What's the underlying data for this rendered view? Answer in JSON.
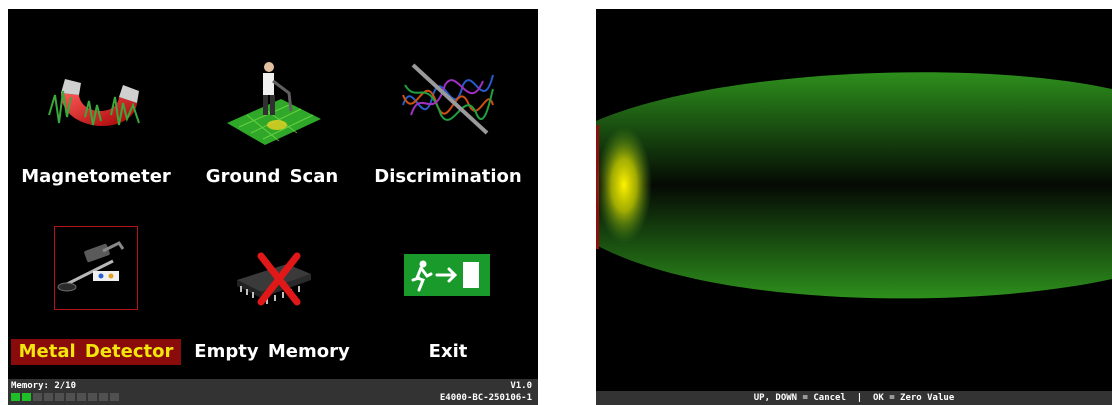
{
  "menu": {
    "items": [
      {
        "label": "Magnetometer",
        "icon": "magnet-icon"
      },
      {
        "label": "Ground  Scan",
        "icon": "ground-scan-icon"
      },
      {
        "label": "Discrimination",
        "icon": "discrimination-icon"
      },
      {
        "label": "Metal  Detector",
        "icon": "metal-detector-icon",
        "selected": true
      },
      {
        "label": "Empty  Memory",
        "icon": "empty-memory-icon"
      },
      {
        "label": "Exit",
        "icon": "exit-icon"
      }
    ]
  },
  "status": {
    "memory_label": "Memory: 2/10",
    "memory_used": 2,
    "memory_total": 10,
    "version": "V1.0",
    "build": "E4000-BC-250106-1"
  },
  "scan": {
    "hint": "UP, DOWN = Cancel  |  OK = Zero Value"
  },
  "colors": {
    "selected_bg": "#8a0b0b",
    "selected_text": "#f2e50c",
    "memory_used": "#1fbf2a",
    "scan_green": "#1e7a14",
    "exit_green": "#1a9a2a"
  }
}
